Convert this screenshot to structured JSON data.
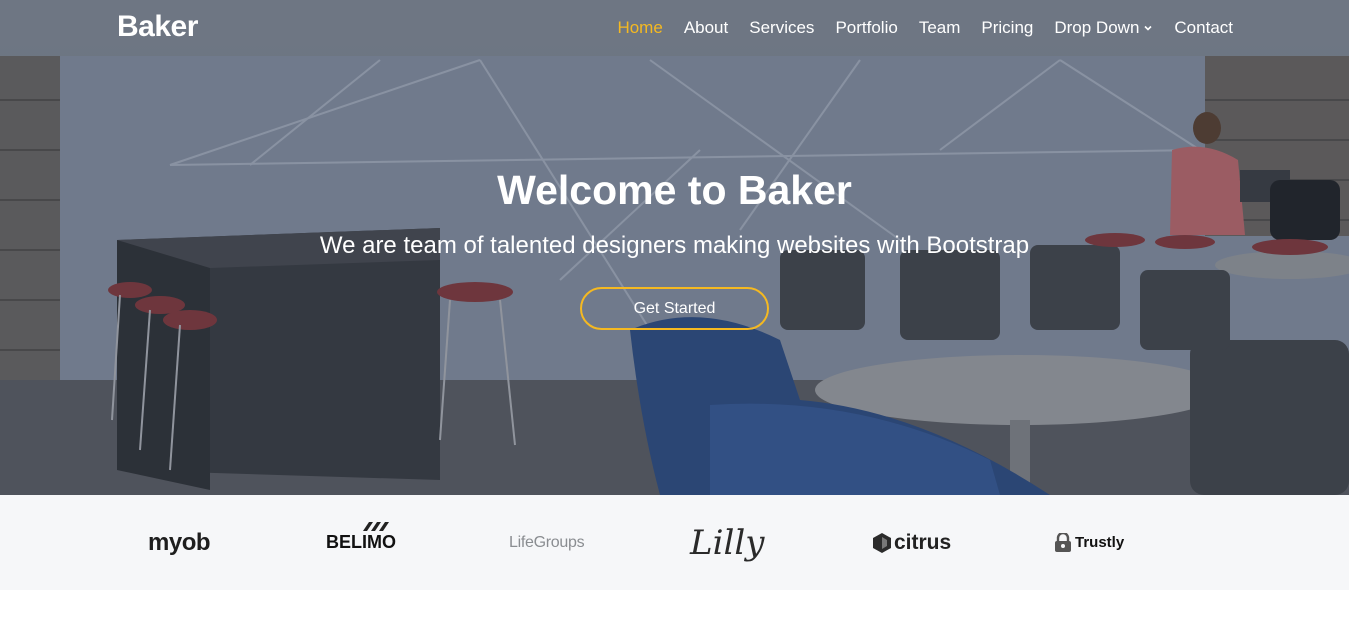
{
  "header": {
    "logo": "Baker",
    "nav": [
      {
        "label": "Home",
        "active": true
      },
      {
        "label": "About"
      },
      {
        "label": "Services"
      },
      {
        "label": "Portfolio"
      },
      {
        "label": "Team"
      },
      {
        "label": "Pricing"
      },
      {
        "label": "Drop Down",
        "icon": "chevron-down-icon"
      },
      {
        "label": "Contact"
      }
    ]
  },
  "hero": {
    "title": "Welcome to Baker",
    "subtitle": "We are team of talented designers making websites with Bootstrap",
    "cta_label": "Get Started"
  },
  "clients": [
    "myob",
    "BELIMO",
    "LifeGroups",
    "Lilly",
    "citrus",
    "Trustly"
  ],
  "colors": {
    "accent": "#f5b921",
    "header_bg": "#6e7682",
    "clients_bg": "#f6f7f9"
  }
}
